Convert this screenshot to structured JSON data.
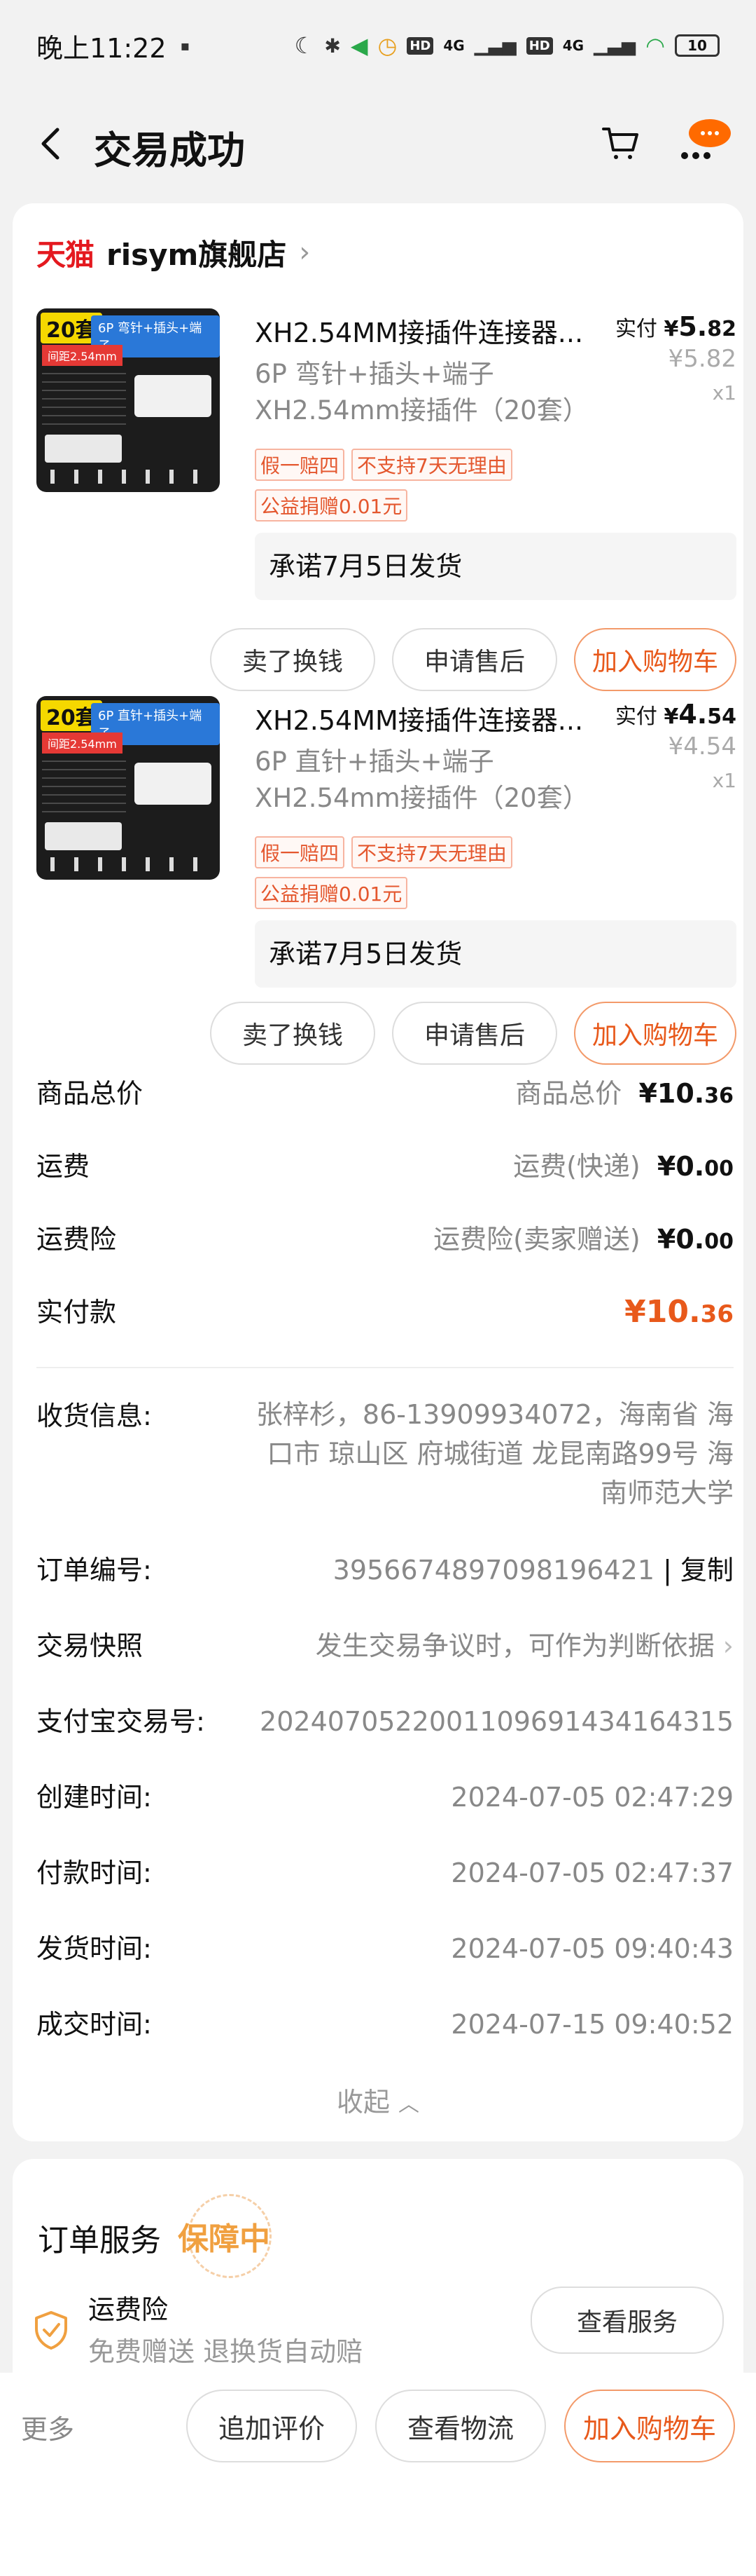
{
  "status_bar": {
    "time": "晚上11:22",
    "battery": "10",
    "net1": "4G",
    "net2": "4G",
    "hd1": "HD",
    "hd2": "HD"
  },
  "nav": {
    "title": "交易成功",
    "badge_dots": "•••"
  },
  "shop": {
    "platform_logo": "天猫",
    "name": "risym旗舰店"
  },
  "products": [
    {
      "title": "XH2.54MM接插件连接器...",
      "spec": "6P 弯针+插头+端子 XH2.54mm接插件（20套）",
      "paid_label": "实付",
      "paid_currency": "¥",
      "paid_int": "5.",
      "paid_dec": "82",
      "orig_price": "¥5.82",
      "qty": "x1",
      "tags": [
        "假一赔四",
        "不支持7天无理由"
      ],
      "charity_tag": "公益捐赠0.01元",
      "promise": "承诺7月5日发货",
      "thumb": {
        "count": "20套",
        "bar": "6P 弯针+插头+端子",
        "pitch": "间距2.54mm"
      },
      "buttons": [
        "卖了换钱",
        "申请售后",
        "加入购物车"
      ]
    },
    {
      "title": "XH2.54MM接插件连接器...",
      "spec": "6P 直针+插头+端子 XH2.54mm接插件（20套）",
      "paid_label": "实付",
      "paid_currency": "¥",
      "paid_int": "4.",
      "paid_dec": "54",
      "orig_price": "¥4.54",
      "qty": "x1",
      "tags": [
        "假一赔四",
        "不支持7天无理由"
      ],
      "charity_tag": "公益捐赠0.01元",
      "promise": "承诺7月5日发货",
      "thumb": {
        "count": "20套",
        "bar": "6P 直针+插头+端子",
        "pitch": "间距2.54mm"
      },
      "buttons": [
        "卖了换钱",
        "申请售后",
        "加入购物车"
      ]
    }
  ],
  "summary": {
    "goods_total": {
      "label": "商品总价",
      "sub": "商品总价",
      "value": "¥10.",
      "dec": "36"
    },
    "shipping": {
      "label": "运费",
      "sub": "运费(快递)",
      "value": "¥0.",
      "dec": "00"
    },
    "shipping_insurance": {
      "label": "运费险",
      "sub": "运费险(卖家赠送)",
      "value": "¥0.",
      "dec": "00"
    },
    "paid": {
      "label": "实付款",
      "value": "¥10.",
      "dec": "36"
    }
  },
  "info": {
    "address_label": "收货信息:",
    "address": "张梓杉，86-13909934072，海南省 海口市 琼山区 府城街道 龙昆南路99号 海南师范大学",
    "order_no_label": "订单编号:",
    "order_no": "3956674897098196421",
    "copy": "复制",
    "snapshot_label": "交易快照",
    "snapshot_value": "发生交易争议时，可作为判断依据",
    "alipay_label": "支付宝交易号:",
    "alipay_no": "2024070522001109691434164315",
    "created_label": "创建时间:",
    "created": "2024-07-05 02:47:29",
    "paid_label": "付款时间:",
    "paid": "2024-07-05 02:47:37",
    "shipped_label": "发货时间:",
    "shipped": "2024-07-05 09:40:43",
    "closed_label": "成交时间:",
    "closed": "2024-07-15 09:40:52",
    "collapse": "收起"
  },
  "service": {
    "title": "订单服务",
    "badge": "保障中",
    "item_name": "运费险",
    "item_desc": "免费赠送  退换货自动赔",
    "button": "查看服务"
  },
  "bottom_bar": {
    "more": "更多",
    "buttons": [
      "追加评价",
      "查看物流",
      "加入购物车"
    ]
  },
  "colors": {
    "accent": "#e8591b",
    "tmall_red": "#e4191f",
    "badge_orange": "#ff6a00"
  }
}
